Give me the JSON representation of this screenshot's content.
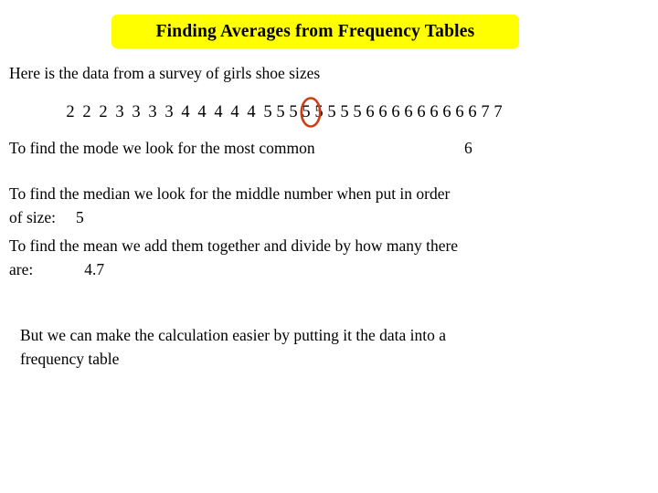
{
  "slide": {
    "title": "Finding Averages from Frequency Tables",
    "title_bg_color": "#ffff00",
    "background_color": "#ffffff",
    "intro": "Here is the data from a survey of girls shoe sizes",
    "data_sequence": [
      "2",
      "2",
      "2",
      "3",
      "3",
      "3",
      "3",
      "4",
      "4",
      "4",
      "4",
      "4",
      "5",
      "5",
      "5",
      "5",
      "5",
      "5",
      "5",
      "5",
      "6",
      "6",
      "6",
      "6",
      "6",
      "6",
      "6",
      "6",
      "6",
      "7",
      "7"
    ],
    "circled_index": 14,
    "circle_color": "#cc3d14",
    "mode": {
      "text": "To find the mode we look for the most common",
      "value": "6"
    },
    "median": {
      "line1": "To find the median we look for the middle number when put in order",
      "line2_label": "of size:",
      "value": "5"
    },
    "mean": {
      "line1": "To find the mean we add them together and divide by how many there",
      "line2_label": "are:",
      "value": "4.7"
    },
    "outro": {
      "line1": "But we can make the calculation easier by putting it the data into a",
      "line2": "frequency table"
    }
  }
}
